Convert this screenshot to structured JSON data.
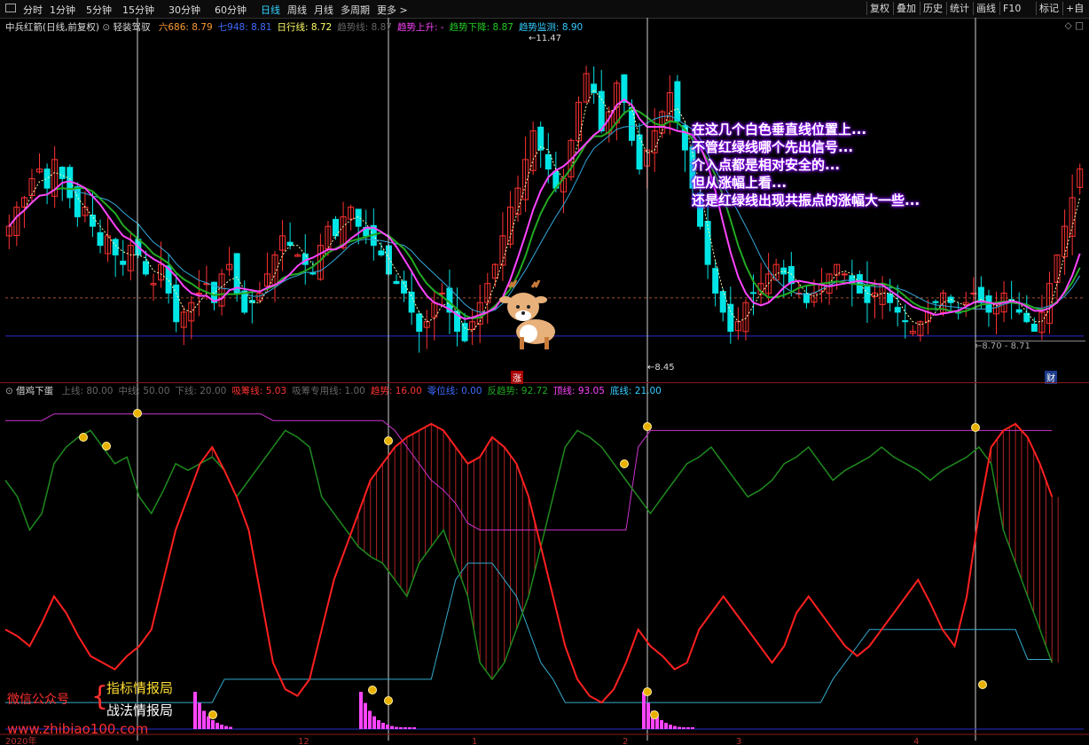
{
  "toolbar": {
    "left_items": [
      "分时",
      "1分钟",
      "5分钟",
      "15分钟",
      "30分钟",
      "60分钟",
      "日线",
      "周线",
      "月线",
      "多周期",
      "更多 >"
    ],
    "active_item": "日线",
    "right_items": [
      "复权",
      "叠加",
      "历史",
      "统计",
      "画线",
      "F10",
      "标记",
      "+自"
    ]
  },
  "main_legend": {
    "stock": "中兵红箭(日线,前复权)",
    "indicator": "轻装驾驭",
    "items": [
      {
        "text": "六686: 8.79",
        "color": "#ff9933"
      },
      {
        "text": "七948: 8.81",
        "color": "#3d6bff"
      },
      {
        "text": "日行线: 8.72",
        "color": "#ffff66"
      },
      {
        "text": "趋势线: 8.87",
        "color": "#666666"
      },
      {
        "text": "趋势上升: -",
        "color": "#ff44ff"
      },
      {
        "text": "趋势下降: 8.87",
        "color": "#22cc22"
      },
      {
        "text": "趋势监测: 8.90",
        "color": "#33ccff"
      }
    ]
  },
  "sub_legend": {
    "name": "借鸡下蛋",
    "items": [
      {
        "text": "上线: 80.00",
        "color": "#666666"
      },
      {
        "text": "中线: 50.00",
        "color": "#666666"
      },
      {
        "text": "下线: 20.00",
        "color": "#666666"
      },
      {
        "text": "吸筹线: 5.03",
        "color": "#ff3333"
      },
      {
        "text": "吸筹专用线: 1.00",
        "color": "#666666"
      },
      {
        "text": "趋势: 16.00",
        "color": "#ff3333"
      },
      {
        "text": "零位线: 0.00",
        "color": "#3d6bff"
      },
      {
        "text": "反趋势: 92.72",
        "color": "#22aa22"
      },
      {
        "text": "顶线: 93.05",
        "color": "#ff44ff"
      },
      {
        "text": "底线: 21.00",
        "color": "#33ccff"
      }
    ]
  },
  "price_marks": {
    "high": "11.47",
    "low": "8.45",
    "range": "8.70 - 8.71",
    "tag_zhang": "涨",
    "tag_cai": "财"
  },
  "annotation": [
    "在这几个白色垂直线位置上...",
    "不管红绿线哪个先出信号...",
    "介入点都是相对安全的...",
    "但从涨幅上看...",
    "还是红绿线出现共振点的涨幅大一些..."
  ],
  "watermark": {
    "label": "微信公众号",
    "line1": "指标情报局",
    "line2": "战法情报局",
    "url": "www.zhibiao100.com"
  },
  "x_axis": [
    "2020年",
    "12",
    "1",
    "2",
    "3",
    "4"
  ],
  "colors": {
    "up": "#ff3232",
    "down": "#00e5e5",
    "ma_magenta": "#ff44ff",
    "ma_green": "#22aa22",
    "ma_blue": "#33aadd",
    "red_line": "#ff2020",
    "green_line": "#1f8a1f",
    "top_line": "#cc33cc",
    "bottom_line": "#33aacc"
  },
  "chart_data": [
    {
      "type": "line",
      "title": "中兵红箭(日线,前复权)",
      "high_marker": 11.47,
      "low_marker": 8.45,
      "close": [
        9.6,
        9.8,
        9.9,
        10.1,
        10.2,
        10.0,
        10.3,
        10.1,
        9.9,
        9.7,
        9.8,
        9.6,
        9.4,
        9.5,
        9.3,
        9.2,
        9.4,
        9.3,
        9.1,
        9.0,
        9.2,
        8.9,
        8.6,
        8.7,
        8.8,
        8.9,
        9.0,
        8.8,
        9.1,
        9.2,
        8.9,
        8.7,
        8.8,
        8.9,
        9.1,
        9.3,
        9.5,
        9.4,
        9.3,
        9.2,
        9.1,
        9.4,
        9.6,
        9.5,
        9.7,
        9.8,
        9.6,
        9.5,
        9.4,
        9.3,
        9.1,
        9.0,
        8.9,
        8.7,
        8.5,
        8.6,
        8.8,
        8.9,
        8.7,
        8.5,
        8.4,
        8.6,
        8.8,
        9.0,
        9.2,
        9.5,
        9.8,
        10.0,
        10.3,
        10.6,
        10.4,
        10.2,
        10.0,
        10.1,
        10.5,
        10.9,
        11.2,
        11.0,
        10.6,
        10.8,
        11.1,
        10.9,
        10.5,
        10.2,
        10.4,
        10.6,
        10.8,
        11.0,
        10.7,
        10.4,
        10.0,
        9.6,
        9.2,
        8.9,
        8.7,
        8.5,
        8.6,
        8.8,
        8.9,
        9.0,
        9.1,
        9.2,
        9.1,
        9.0,
        8.9,
        8.8,
        8.9,
        9.0,
        9.1,
        9.2,
        9.1,
        9.0,
        8.9,
        8.8,
        8.9,
        9.0,
        8.8,
        8.7,
        8.6,
        8.5,
        8.6,
        8.7,
        8.8,
        8.9,
        8.8,
        8.7,
        8.8,
        8.9,
        8.8,
        8.7,
        8.8,
        8.9,
        8.8,
        8.7,
        8.6,
        8.5,
        8.7,
        9.0,
        9.3,
        9.6,
        9.9,
        10.2
      ]
    },
    {
      "type": "line",
      "title": "借鸡下蛋",
      "ylim": [
        0,
        100
      ],
      "series": [
        {
          "name": "吸筹线",
          "values": [
            30,
            28,
            25,
            32,
            40,
            35,
            28,
            22,
            20,
            18,
            22,
            25,
            30,
            45,
            60,
            70,
            80,
            85,
            78,
            70,
            60,
            40,
            20,
            12,
            10,
            15,
            30,
            45,
            55,
            65,
            75,
            80,
            85,
            88,
            90,
            92,
            90,
            85,
            80,
            82,
            88,
            85,
            80,
            70,
            55,
            40,
            25,
            15,
            10,
            8,
            12,
            20,
            30,
            25,
            22,
            18,
            20,
            30,
            35,
            40,
            35,
            30,
            25,
            20,
            25,
            35,
            40,
            35,
            30,
            25,
            22,
            25,
            30,
            35,
            40,
            45,
            38,
            30,
            25,
            40,
            65,
            85,
            90,
            92,
            88,
            80,
            70
          ]
        },
        {
          "name": "反趋势",
          "values": [
            75,
            70,
            60,
            65,
            80,
            85,
            88,
            90,
            85,
            80,
            82,
            70,
            65,
            72,
            80,
            78,
            80,
            82,
            78,
            70,
            75,
            80,
            85,
            90,
            88,
            85,
            70,
            65,
            60,
            55,
            52,
            50,
            45,
            40,
            50,
            55,
            60,
            50,
            40,
            20,
            15,
            20,
            30,
            40,
            55,
            70,
            85,
            90,
            88,
            85,
            80,
            75,
            70,
            65,
            70,
            75,
            80,
            82,
            85,
            80,
            75,
            70,
            72,
            75,
            80,
            82,
            85,
            80,
            75,
            78,
            80,
            82,
            85,
            82,
            80,
            78,
            75,
            78,
            80,
            82,
            85,
            80,
            60,
            50,
            40,
            30,
            20
          ]
        },
        {
          "name": "顶线",
          "values": [
            93,
            93,
            93,
            93,
            95,
            95,
            95,
            95,
            95,
            95,
            95,
            95,
            95,
            95,
            95,
            95,
            95,
            95,
            95,
            95,
            95,
            95,
            93,
            93,
            93,
            93,
            93,
            93,
            93,
            93,
            93,
            93,
            90,
            85,
            80,
            75,
            72,
            68,
            62,
            60,
            60,
            60,
            60,
            60,
            60,
            60,
            60,
            60,
            60,
            60,
            60,
            60,
            85,
            90,
            90,
            90,
            90,
            90,
            90,
            90,
            90,
            90,
            90,
            90,
            90,
            90,
            90,
            90,
            90,
            90,
            90,
            90,
            90,
            90,
            90,
            90,
            90,
            90,
            90,
            90,
            90,
            90,
            90,
            90,
            90,
            90,
            90
          ]
        },
        {
          "name": "底线",
          "values": [
            8,
            8,
            8,
            8,
            8,
            8,
            8,
            8,
            8,
            8,
            8,
            8,
            8,
            8,
            8,
            8,
            8,
            8,
            15,
            15,
            15,
            15,
            15,
            15,
            15,
            15,
            15,
            15,
            15,
            15,
            15,
            15,
            15,
            15,
            15,
            15,
            30,
            45,
            50,
            50,
            50,
            45,
            40,
            30,
            20,
            15,
            8,
            8,
            8,
            8,
            8,
            8,
            8,
            8,
            8,
            8,
            8,
            8,
            8,
            8,
            8,
            8,
            8,
            8,
            8,
            8,
            8,
            8,
            15,
            20,
            25,
            30,
            30,
            30,
            30,
            30,
            30,
            30,
            30,
            30,
            30,
            30,
            30,
            30,
            21,
            21,
            21
          ]
        }
      ]
    }
  ]
}
